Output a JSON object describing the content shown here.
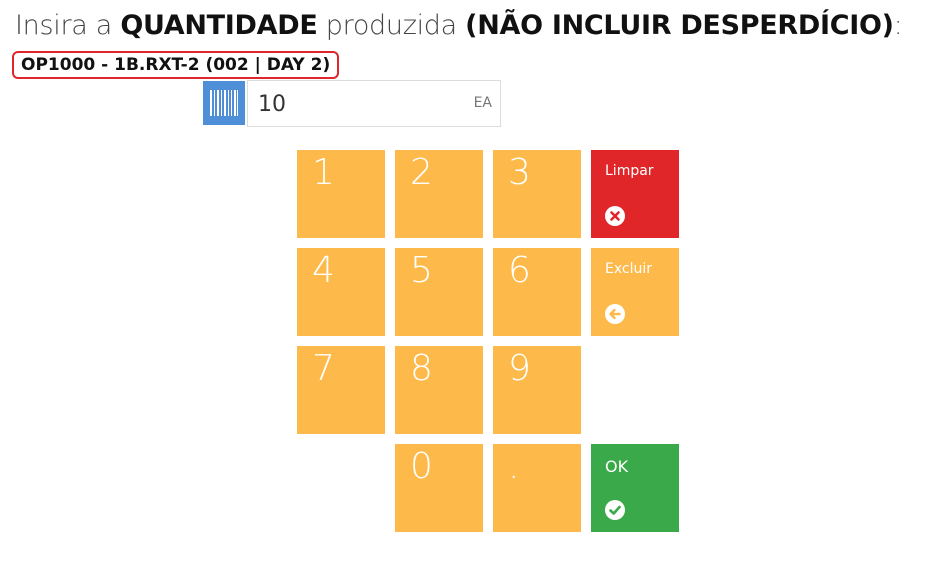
{
  "title": {
    "prefix": "Insira a",
    "emphasis1": "QUANTIDADE",
    "middle": "produzida",
    "emphasis2": "(NÃO INCLUIR DESPERDÍCIO)",
    "suffix": ":"
  },
  "subtitle": "OP1000 - 1B.RXT-2 (002 | DAY 2)",
  "quantity": {
    "value": "10",
    "unit": "EA"
  },
  "keypad": {
    "digits": [
      "1",
      "2",
      "3",
      "4",
      "5",
      "6",
      "7",
      "8",
      "9",
      "0",
      "."
    ],
    "clear_label": "Limpar",
    "delete_label": "Excluir",
    "ok_label": "OK"
  },
  "colors": {
    "key": "#fdb94a",
    "clear": "#e1262a",
    "ok": "#3aa94a",
    "barcode": "#4f8fd8",
    "highlight_border": "#e0262a"
  },
  "icons": {
    "barcode": "barcode-icon",
    "clear": "times-circle-icon",
    "delete": "arrow-circle-left-icon",
    "ok": "check-circle-icon"
  }
}
